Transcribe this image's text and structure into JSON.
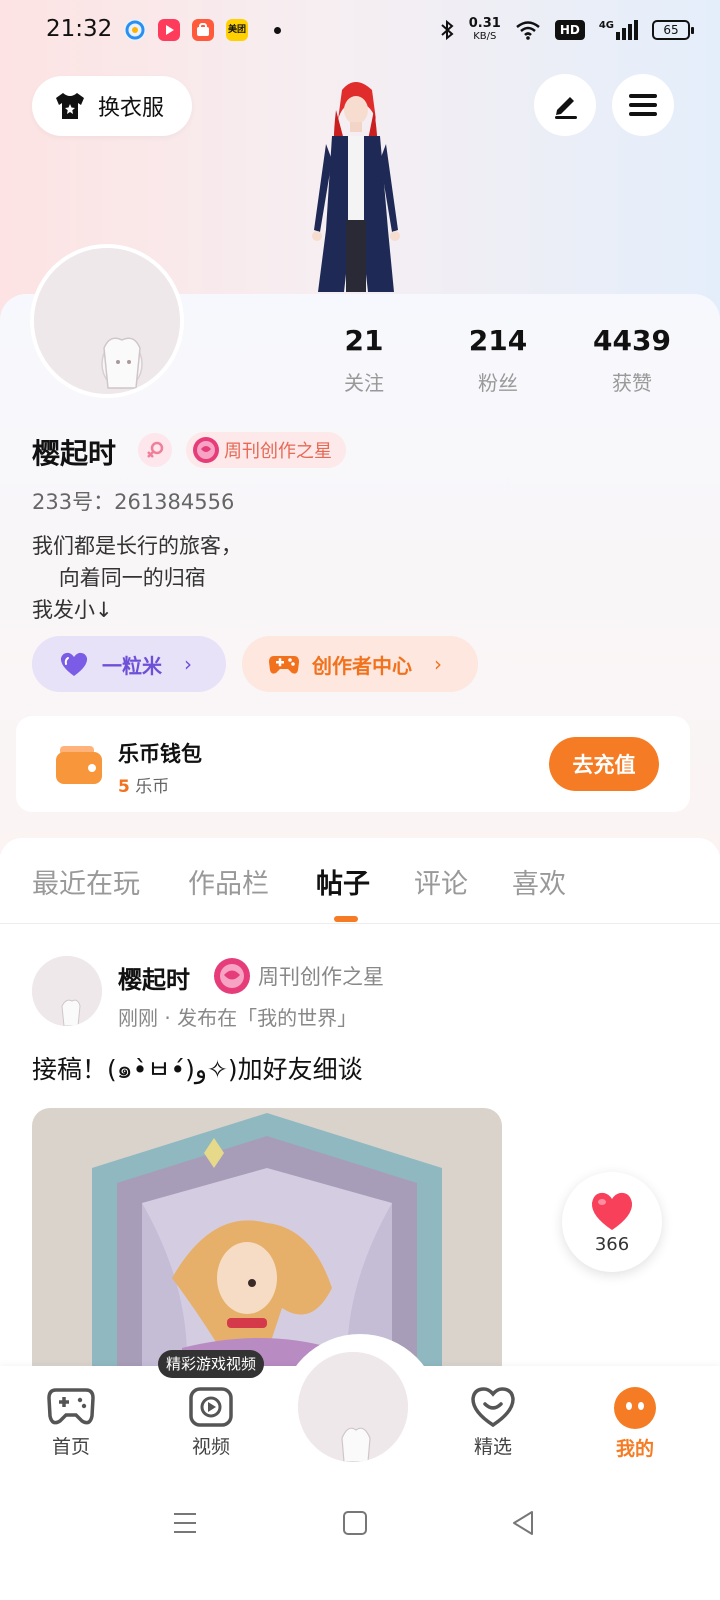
{
  "status_bar": {
    "time": "21:32",
    "net_speed_value": "0.31",
    "net_speed_unit": "KB/S",
    "hd": "HD",
    "signal": "4G",
    "battery": "65",
    "app_icons": [
      "qq-browser-icon",
      "video-app-icon",
      "shop-app-icon",
      "meituan-icon"
    ],
    "meituan_label": "美团"
  },
  "header": {
    "outfit_label": "换衣服"
  },
  "profile": {
    "stats": [
      {
        "num": "21",
        "label": "关注"
      },
      {
        "num": "214",
        "label": "粉丝"
      },
      {
        "num": "4439",
        "label": "获赞"
      }
    ],
    "username": "樱起时",
    "badge": "周刊创作之星",
    "uid": "233号：261384556",
    "bio": "我们都是长行的旅客，\n    向着同一的归宿\n我发小↓",
    "pill_rice": "一粒米",
    "pill_creator": "创作者中心"
  },
  "wallet": {
    "title": "乐币钱包",
    "amount": "5",
    "unit": "乐币",
    "button": "去充值"
  },
  "tabs": [
    "最近在玩",
    "作品栏",
    "帖子",
    "评论",
    "喜欢"
  ],
  "active_tab_index": 2,
  "post": {
    "user": "樱起时",
    "badge": "周刊创作之星",
    "meta": "刚刚 · 发布在「我的世界」",
    "text": "接稿！(๑•̀ㅂ•́)و✧)加好友细谈",
    "likes": "366"
  },
  "bottom_nav": {
    "tooltip": "精彩游戏视频",
    "items": [
      {
        "label": "首页"
      },
      {
        "label": "视频"
      },
      {
        "label": "精选"
      },
      {
        "label": "我的"
      }
    ]
  },
  "colors": {
    "accent": "#f57c24",
    "purple": "#6e4fd8"
  }
}
